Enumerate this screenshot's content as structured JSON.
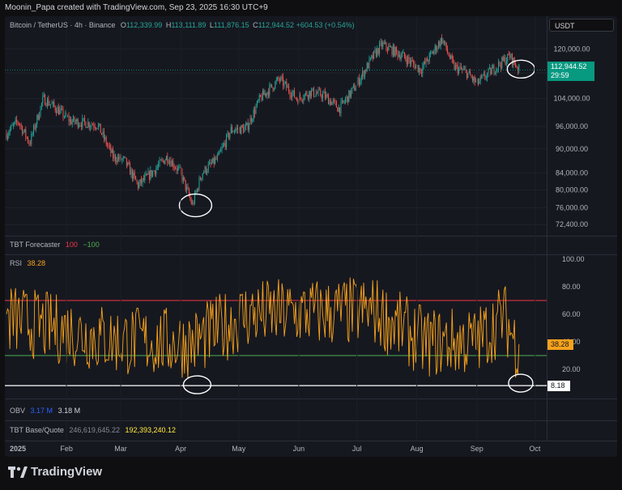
{
  "caption": "Moonin_Papa created with TradingView.com, Sep 23, 2025 16:30 UTC+9",
  "brand": "TradingView",
  "header": {
    "symbol": "Bitcoin / TetherUS · 4h · Binance",
    "o_label": "O",
    "o_value": "112,339.99",
    "h_label": "H",
    "h_value": "113,111.89",
    "l_label": "L",
    "l_value": "111,876.15",
    "c_label": "C",
    "c_value": "112,944.52",
    "change": "+604.53 (+0.54%)"
  },
  "currency": "USDT",
  "last_price": "112,944.52",
  "countdown": "29:59",
  "indicators": {
    "tbt_forecaster": {
      "label": "TBT Forecaster",
      "v1": "100",
      "v2": "−100"
    },
    "rsi": {
      "label": "RSI",
      "value": "38.28"
    },
    "obv": {
      "label": "OBV",
      "v1": "3.17 M",
      "v2": "3.18 M"
    },
    "tbt_base_quote": {
      "label": "TBT Base/Quote",
      "v1": "246,619,645.22",
      "v2": "192,393,240.12"
    }
  },
  "rsi_marker_label": "8.18",
  "colors": {
    "up": "#26a69a",
    "down": "#ef5350",
    "rsi": "#f7a21b",
    "upper_band": "#f23645",
    "lower_band": "#4caf50",
    "marker": "#ffffff",
    "obv_v1": "#2962ff",
    "tbt_v2": "#ffeb3b"
  },
  "chart_data": [
    {
      "type": "candlestick",
      "title": "Bitcoin / TetherUS · 4h · Binance",
      "x_months": [
        "2025",
        "Feb",
        "Mar",
        "Apr",
        "May",
        "Jun",
        "Jul",
        "Aug",
        "Sep",
        "Oct"
      ],
      "y_ticks": [
        120000,
        112000,
        104000,
        96000,
        90000,
        84000,
        80000,
        76000,
        72400
      ],
      "y_tick_labels": [
        "120,000.00",
        "112,000.00",
        "104,000.00",
        "96,000.00",
        "90,000.00",
        "84,000.00",
        "80,000.00",
        "76,000.00",
        "72,400.00"
      ],
      "scale": "log",
      "ylim": [
        70600,
        127000
      ],
      "close_path": [
        [
          "2025-01-01",
          94000
        ],
        [
          "2025-01-07",
          97500
        ],
        [
          "2025-01-13",
          91500
        ],
        [
          "2025-01-20",
          104000
        ],
        [
          "2025-01-27",
          101000
        ],
        [
          "2025-02-03",
          97500
        ],
        [
          "2025-02-10",
          97000
        ],
        [
          "2025-02-17",
          96500
        ],
        [
          "2025-02-25",
          88000
        ],
        [
          "2025-03-03",
          87000
        ],
        [
          "2025-03-10",
          81000
        ],
        [
          "2025-03-17",
          84000
        ],
        [
          "2025-03-25",
          88000
        ],
        [
          "2025-04-01",
          84000
        ],
        [
          "2025-04-07",
          76500
        ],
        [
          "2025-04-12",
          84000
        ],
        [
          "2025-04-20",
          87500
        ],
        [
          "2025-04-27",
          95000
        ],
        [
          "2025-05-05",
          95500
        ],
        [
          "2025-05-12",
          104000
        ],
        [
          "2025-05-22",
          110000
        ],
        [
          "2025-05-31",
          104000
        ],
        [
          "2025-06-07",
          106000
        ],
        [
          "2025-06-14",
          105000
        ],
        [
          "2025-06-22",
          101000
        ],
        [
          "2025-06-30",
          107500
        ],
        [
          "2025-07-10",
          118000
        ],
        [
          "2025-07-14",
          121500
        ],
        [
          "2025-07-25",
          117500
        ],
        [
          "2025-08-03",
          113000
        ],
        [
          "2025-08-14",
          123500
        ],
        [
          "2025-08-20",
          114000
        ],
        [
          "2025-08-27",
          112000
        ],
        [
          "2025-09-01",
          108500
        ],
        [
          "2025-09-10",
          113500
        ],
        [
          "2025-09-18",
          117500
        ],
        [
          "2025-09-23",
          112944.52
        ]
      ]
    },
    {
      "type": "line",
      "title": "RSI",
      "ylim": [
        0,
        100
      ],
      "y_ticks": [
        100,
        80,
        60,
        40,
        20
      ],
      "y_tick_labels": [
        "100.00",
        "80.00",
        "60.00",
        "40.00",
        "20.00"
      ],
      "upper_band": 70,
      "lower_band": 30,
      "current_value": 38.28,
      "marker_level": 8.18,
      "key_points": [
        [
          "2025-01-01",
          70
        ],
        [
          "2025-02-25",
          25
        ],
        [
          "2025-04-07",
          18
        ],
        [
          "2025-05-05",
          78
        ],
        [
          "2025-07-10",
          85
        ],
        [
          "2025-08-05",
          20
        ],
        [
          "2025-09-01",
          22
        ],
        [
          "2025-09-15",
          75
        ],
        [
          "2025-09-22",
          12
        ],
        [
          "2025-09-23",
          38.28
        ]
      ]
    }
  ]
}
